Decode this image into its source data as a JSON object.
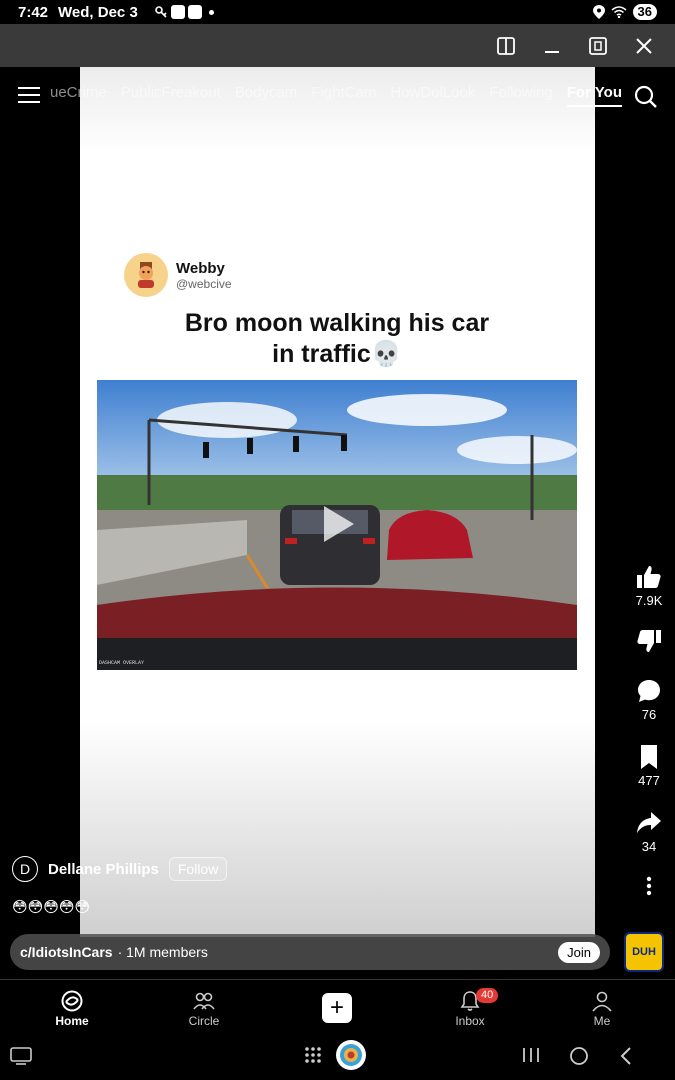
{
  "status_bar": {
    "time": "7:42",
    "date": "Wed, Dec 3",
    "battery": "36"
  },
  "nav_tabs": [
    "ueCrime",
    "PublicFreakout",
    "Bodycam",
    "FightCam",
    "HowDolLook",
    "Following",
    "For You"
  ],
  "active_tab": "For You",
  "post": {
    "tweet_name": "Webby",
    "tweet_handle": "@webcive",
    "tweet_text_line1": "Bro moon walking his car",
    "tweet_text_line2": "in traffic💀"
  },
  "actions": {
    "likes": "7.9K",
    "comments": "76",
    "saves": "477",
    "shares": "34"
  },
  "author": {
    "initial": "D",
    "name": "Dellane Phillips",
    "follow_label": "Follow",
    "caption": "😳😳😳😳😳"
  },
  "community": {
    "name": "c/IdiotsInCars",
    "members": "· 1M members",
    "join_label": "Join",
    "badge_text": "DUH"
  },
  "bottom_nav": {
    "home": "Home",
    "circle": "Circle",
    "inbox": "Inbox",
    "inbox_badge": "40",
    "me": "Me"
  },
  "colors": {
    "badge": "#e53935",
    "window_bar": "#3a3a3a"
  }
}
